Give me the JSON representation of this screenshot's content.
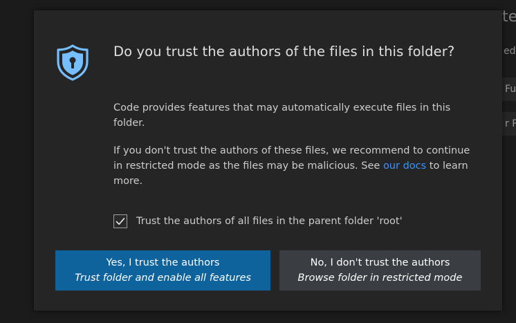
{
  "background": {
    "fragments": [
      "te",
      "ed",
      "Fu",
      "r P"
    ]
  },
  "dialog": {
    "title": "Do you trust the authors of the files in this folder?",
    "paragraph1": "Code provides features that may automatically execute files in this folder.",
    "paragraph2_before": "If you don't trust the authors of these files, we recommend to continue in restricted mode as the files may be malicious. See ",
    "paragraph2_link": "our docs",
    "paragraph2_after": " to learn more.",
    "checkbox": {
      "checked": true,
      "label": "Trust the authors of all files in the parent folder 'root'"
    },
    "buttons": {
      "trust": {
        "label": "Yes, I trust the authors",
        "sublabel": "Trust folder and enable all features"
      },
      "restricted": {
        "label": "No, I don't trust the authors",
        "sublabel": "Browse folder in restricted mode"
      }
    }
  },
  "colors": {
    "accent": "#0e639c",
    "link": "#3794ff",
    "icon": "#75beff",
    "dialog_bg": "#252526"
  },
  "icons": {
    "shield": "shield-lock-icon",
    "check": "check-icon"
  }
}
